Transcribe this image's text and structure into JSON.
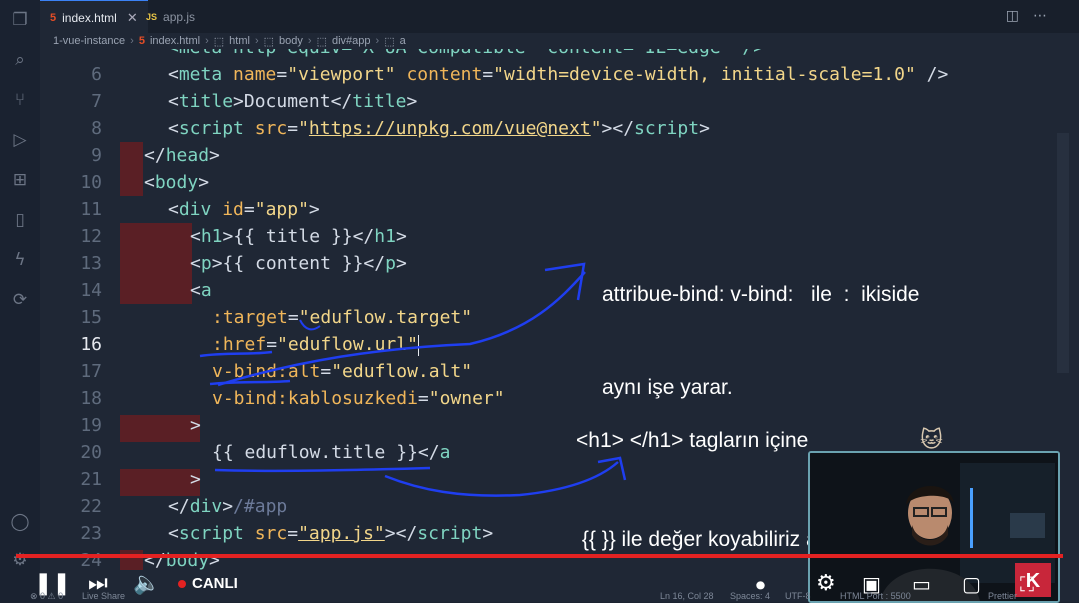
{
  "tabs": [
    {
      "icon": "html-file-icon",
      "label": "index.html",
      "active": true
    },
    {
      "icon": "js-file-icon",
      "label": "app.js",
      "active": false
    }
  ],
  "breadcrumb": [
    "1-vue-instance",
    "index.html",
    "html",
    "body",
    "div#app",
    "a"
  ],
  "editor": {
    "partial_line": "<meta http-equiv=\"X-UA-Compatible\" content=\"IE=edge\" />",
    "lines": [
      {
        "n": "6"
      },
      {
        "n": "7"
      },
      {
        "n": "8"
      },
      {
        "n": "9"
      },
      {
        "n": "10"
      },
      {
        "n": "11"
      },
      {
        "n": "12"
      },
      {
        "n": "13"
      },
      {
        "n": "14"
      },
      {
        "n": "15"
      },
      {
        "n": "16"
      },
      {
        "n": "17"
      },
      {
        "n": "18"
      },
      {
        "n": "19"
      },
      {
        "n": "20"
      },
      {
        "n": "21"
      },
      {
        "n": "22"
      },
      {
        "n": "23"
      },
      {
        "n": "24"
      }
    ],
    "current_line": "16",
    "code": {
      "l6": {
        "tag": "meta",
        "a1": "name",
        "v1": "\"viewport\"",
        "a2": "content",
        "v2": "\"width=device-width, initial-scale=1.0\""
      },
      "l7": {
        "open": "title",
        "text": "Document",
        "close": "title"
      },
      "l8": {
        "tag": "script",
        "attr": "src",
        "url": "https://unpkg.com/vue@next",
        "close": "script"
      },
      "l9": {
        "close": "head"
      },
      "l10": {
        "open": "body"
      },
      "l11": {
        "tag": "div",
        "attr": "id",
        "val": "\"app\""
      },
      "l12": {
        "open": "h1",
        "text": "{{ title }}",
        "close": "h1"
      },
      "l13": {
        "open": "p",
        "text": "{{ content }}",
        "close": "p"
      },
      "l14": {
        "tag": "a"
      },
      "l15": {
        "attr": ":target",
        "val": "\"eduflow.target\""
      },
      "l16": {
        "attr": ":href",
        "val": "\"eduflow.url\""
      },
      "l17": {
        "attr": "v-bind:alt",
        "val": "\"eduflow.alt\""
      },
      "l18": {
        "attr": "v-bind:kablosuzkedi",
        "val": "\"owner\""
      },
      "l19": {
        "text": ">"
      },
      "l20": {
        "text": "{{ eduflow.title }}",
        "close": "a"
      },
      "l21": {
        "text": ">"
      },
      "l22": {
        "close": "div",
        "comment": "#app"
      },
      "l23": {
        "tag": "script",
        "attr": "src",
        "val": "\"app.js\"",
        "close": "script"
      },
      "l24": {
        "close": "body"
      }
    }
  },
  "annotations": {
    "note1_line1": "attribue-bind: v-bind:   ile  :  ikiside",
    "note1_line2": "aynı işe yarar.",
    "note2_line1": "<h1> </h1> tagların içine",
    "note2_line2": " {{ }} ile değer koyabiliriz ancak",
    "ink_color": "#1f3ef0"
  },
  "player": {
    "live_label": "CANLI",
    "progress": 1.0,
    "progress_color": "#e32222"
  },
  "status": {
    "left": "⊗ 0 ⚠ 0",
    "live_share": "Live Share",
    "position": "Ln 16, Col 28",
    "spaces": "Spaces: 4",
    "encoding": "UTF-8",
    "port": "HTML Port : 5500",
    "prettier": "Prettier"
  }
}
